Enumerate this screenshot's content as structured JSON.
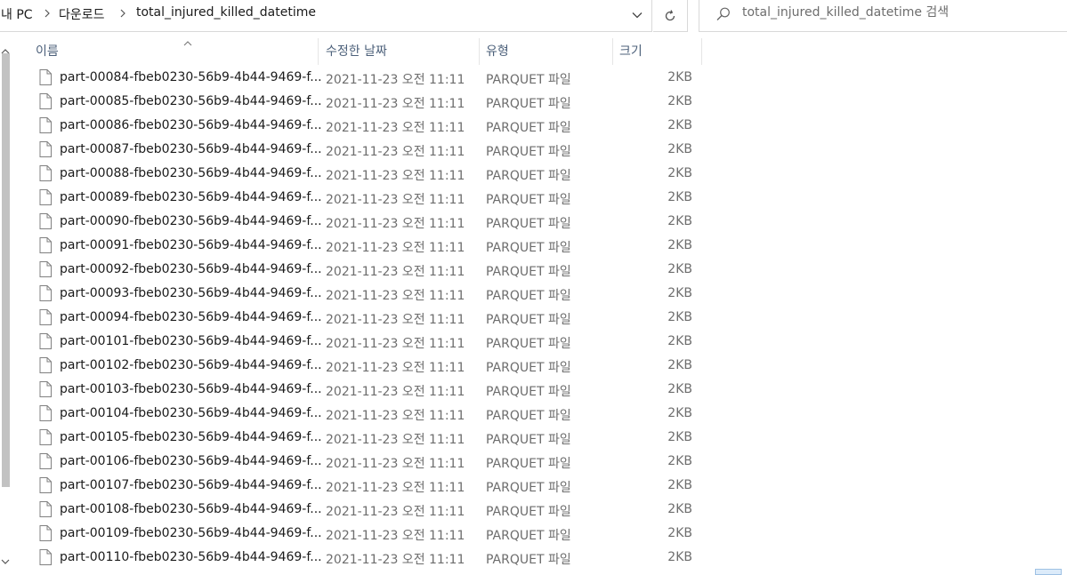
{
  "breadcrumb": {
    "items": [
      "내 PC",
      "다운로드",
      "total_injured_killed_datetime"
    ]
  },
  "search": {
    "placeholder": "total_injured_killed_datetime 검색"
  },
  "columns": {
    "name": "이름",
    "modified": "수정한 날짜",
    "type": "유형",
    "size": "크기"
  },
  "files": [
    {
      "name": "part-00084-fbeb0230-56b9-4b44-9469-f...",
      "modified": "2021-11-23 오전 11:11",
      "type": "PARQUET 파일",
      "size": "2KB"
    },
    {
      "name": "part-00085-fbeb0230-56b9-4b44-9469-f...",
      "modified": "2021-11-23 오전 11:11",
      "type": "PARQUET 파일",
      "size": "2KB"
    },
    {
      "name": "part-00086-fbeb0230-56b9-4b44-9469-f...",
      "modified": "2021-11-23 오전 11:11",
      "type": "PARQUET 파일",
      "size": "2KB"
    },
    {
      "name": "part-00087-fbeb0230-56b9-4b44-9469-f...",
      "modified": "2021-11-23 오전 11:11",
      "type": "PARQUET 파일",
      "size": "2KB"
    },
    {
      "name": "part-00088-fbeb0230-56b9-4b44-9469-f...",
      "modified": "2021-11-23 오전 11:11",
      "type": "PARQUET 파일",
      "size": "2KB"
    },
    {
      "name": "part-00089-fbeb0230-56b9-4b44-9469-f...",
      "modified": "2021-11-23 오전 11:11",
      "type": "PARQUET 파일",
      "size": "2KB"
    },
    {
      "name": "part-00090-fbeb0230-56b9-4b44-9469-f...",
      "modified": "2021-11-23 오전 11:11",
      "type": "PARQUET 파일",
      "size": "2KB"
    },
    {
      "name": "part-00091-fbeb0230-56b9-4b44-9469-f...",
      "modified": "2021-11-23 오전 11:11",
      "type": "PARQUET 파일",
      "size": "2KB"
    },
    {
      "name": "part-00092-fbeb0230-56b9-4b44-9469-f...",
      "modified": "2021-11-23 오전 11:11",
      "type": "PARQUET 파일",
      "size": "2KB"
    },
    {
      "name": "part-00093-fbeb0230-56b9-4b44-9469-f...",
      "modified": "2021-11-23 오전 11:11",
      "type": "PARQUET 파일",
      "size": "2KB"
    },
    {
      "name": "part-00094-fbeb0230-56b9-4b44-9469-f...",
      "modified": "2021-11-23 오전 11:11",
      "type": "PARQUET 파일",
      "size": "2KB"
    },
    {
      "name": "part-00101-fbeb0230-56b9-4b44-9469-f...",
      "modified": "2021-11-23 오전 11:11",
      "type": "PARQUET 파일",
      "size": "2KB"
    },
    {
      "name": "part-00102-fbeb0230-56b9-4b44-9469-f...",
      "modified": "2021-11-23 오전 11:11",
      "type": "PARQUET 파일",
      "size": "2KB"
    },
    {
      "name": "part-00103-fbeb0230-56b9-4b44-9469-f...",
      "modified": "2021-11-23 오전 11:11",
      "type": "PARQUET 파일",
      "size": "2KB"
    },
    {
      "name": "part-00104-fbeb0230-56b9-4b44-9469-f...",
      "modified": "2021-11-23 오전 11:11",
      "type": "PARQUET 파일",
      "size": "2KB"
    },
    {
      "name": "part-00105-fbeb0230-56b9-4b44-9469-f...",
      "modified": "2021-11-23 오전 11:11",
      "type": "PARQUET 파일",
      "size": "2KB"
    },
    {
      "name": "part-00106-fbeb0230-56b9-4b44-9469-f...",
      "modified": "2021-11-23 오전 11:11",
      "type": "PARQUET 파일",
      "size": "2KB"
    },
    {
      "name": "part-00107-fbeb0230-56b9-4b44-9469-f...",
      "modified": "2021-11-23 오전 11:11",
      "type": "PARQUET 파일",
      "size": "2KB"
    },
    {
      "name": "part-00108-fbeb0230-56b9-4b44-9469-f...",
      "modified": "2021-11-23 오전 11:11",
      "type": "PARQUET 파일",
      "size": "2KB"
    },
    {
      "name": "part-00109-fbeb0230-56b9-4b44-9469-f...",
      "modified": "2021-11-23 오전 11:11",
      "type": "PARQUET 파일",
      "size": "2KB"
    },
    {
      "name": "part-00110-fbeb0230-56b9-4b44-9469-f...",
      "modified": "2021-11-23 오전 11:11",
      "type": "PARQUET 파일",
      "size": "2KB"
    }
  ],
  "icons": {
    "file": "file-icon",
    "search": "search-icon",
    "refresh": "refresh-icon",
    "dropdown": "chevron-down-icon",
    "separator": "chevron-right-icon",
    "sort": "sort-up-icon"
  },
  "colors": {
    "header_text": "#4c607a",
    "secondary_text": "#6d6d6d",
    "scroll_thumb": "#c2c2c2"
  }
}
